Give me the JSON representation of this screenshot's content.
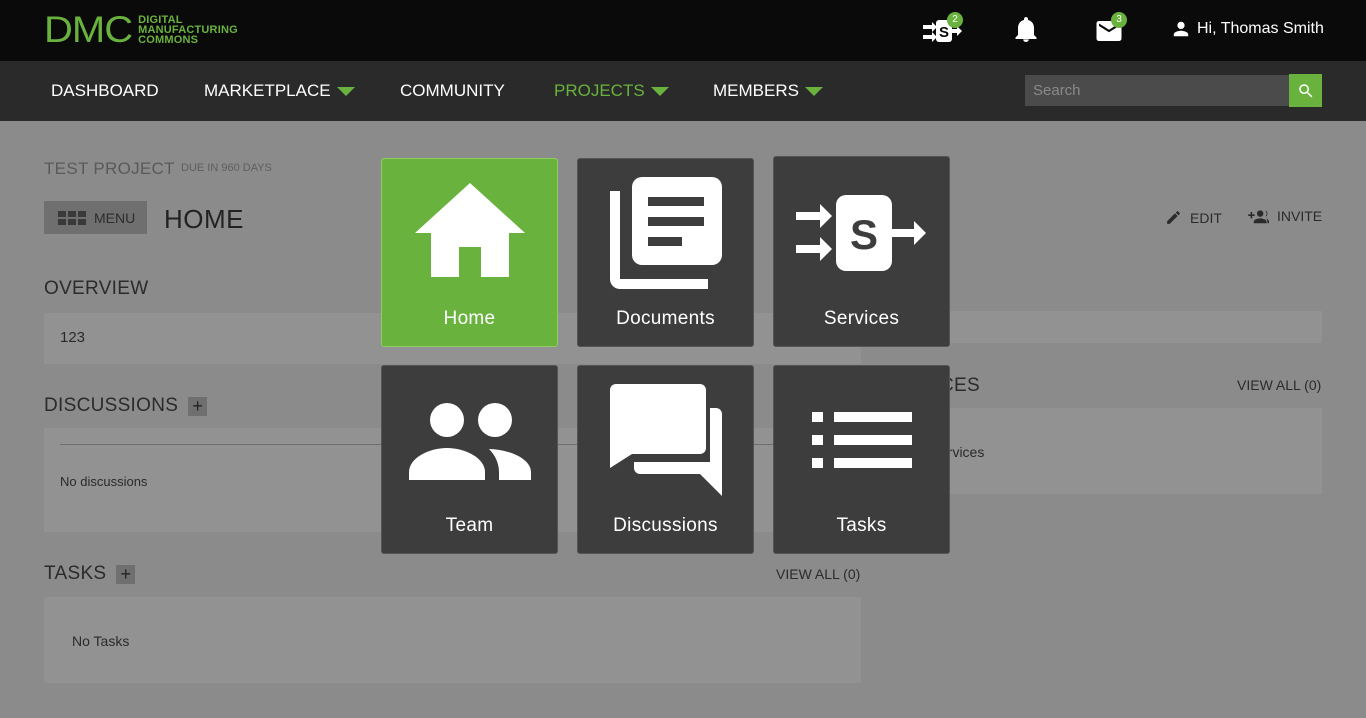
{
  "header": {
    "logo_mark": "DMC",
    "logo_text": [
      "DIGITAL",
      "MANUFACTURING",
      "COMMONS"
    ],
    "services_badge": "2",
    "messages_badge": "3",
    "user_greeting": "Hi, Thomas Smith"
  },
  "nav": {
    "items": [
      {
        "label": "DASHBOARD",
        "dropdown": false,
        "active": false
      },
      {
        "label": "MARKETPLACE",
        "dropdown": true,
        "active": false
      },
      {
        "label": "COMMUNITY",
        "dropdown": false,
        "active": false
      },
      {
        "label": "PROJECTS",
        "dropdown": true,
        "active": true
      },
      {
        "label": "MEMBERS",
        "dropdown": true,
        "active": false
      }
    ],
    "search_placeholder": "Search"
  },
  "project": {
    "name": "TEST PROJECT",
    "due": "DUE IN 960 DAYS",
    "menu_label": "MENU",
    "page_title": "HOME",
    "edit_label": "EDIT",
    "invite_label": "INVITE"
  },
  "overview": {
    "heading": "OVERVIEW",
    "text": "123"
  },
  "discussions": {
    "heading": "DISCUSSIONS",
    "empty": "No discussions"
  },
  "tasks": {
    "heading": "TASKS",
    "view_all": "VIEW ALL (0)",
    "empty": "No Tasks"
  },
  "services": {
    "heading_partial": "CES",
    "view_all": "VIEW ALL (0)",
    "empty_partial": "ervices"
  },
  "menu_tiles": [
    {
      "label": "Home",
      "icon": "home-icon",
      "active": true
    },
    {
      "label": "Documents",
      "icon": "documents-icon",
      "active": false
    },
    {
      "label": "Services",
      "icon": "services-icon",
      "active": false
    },
    {
      "label": "Team",
      "icon": "team-icon",
      "active": false
    },
    {
      "label": "Discussions",
      "icon": "discussions-icon",
      "active": false
    },
    {
      "label": "Tasks",
      "icon": "tasks-icon",
      "active": false
    }
  ],
  "colors": {
    "accent": "#6ab23e",
    "topbar": "#0a0a0a",
    "navbar": "#2a2a2a",
    "tile": "#3d3d3d"
  }
}
